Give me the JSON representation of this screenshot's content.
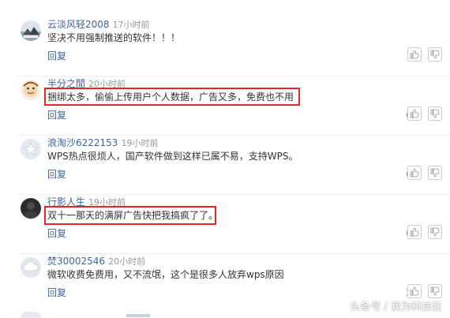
{
  "colors": {
    "username": "#406599",
    "time": "#999999",
    "highlight": "#e8262a",
    "divider": "#eeeeee"
  },
  "comments": [
    {
      "username": "云淡风轻2008",
      "time": "17小时前",
      "text": "坚决不用强制推送的软件！！！",
      "reply": "回复",
      "likes": "1",
      "avatar": "landscape-avatar",
      "highlighted": false
    },
    {
      "username": "半分之閒",
      "time": "20小时前",
      "text": "捆绑太多，偷偷上传用户个人数据，广告又多，免费也不用",
      "reply": "回复",
      "likes": "0",
      "avatar": "cartoon-avatar",
      "highlighted": true
    },
    {
      "username": "浪淘沙6222153",
      "time": "19小时前",
      "text": "WPS热点很烦人，国产软件做到这样已属不易，支持WPS。",
      "reply": "回复",
      "likes": "0",
      "avatar": "default-star-avatar",
      "highlighted": false
    },
    {
      "username": "行影人生",
      "time": "19小时前",
      "text": "双十一那天的满屏广告快把我搞疯了了。",
      "reply": "回复",
      "likes": "0",
      "avatar": "dark-photo-avatar",
      "highlighted": true
    },
    {
      "username": "焚30002546",
      "time": "20小时前",
      "text": "微软收费免费用，又不流氓，这个是很多人放弃wps原因",
      "reply": "回复",
      "likes": "2",
      "avatar": "default-cloud-avatar",
      "highlighted": false
    }
  ],
  "watermark": "头条号 / 我为科技狂"
}
